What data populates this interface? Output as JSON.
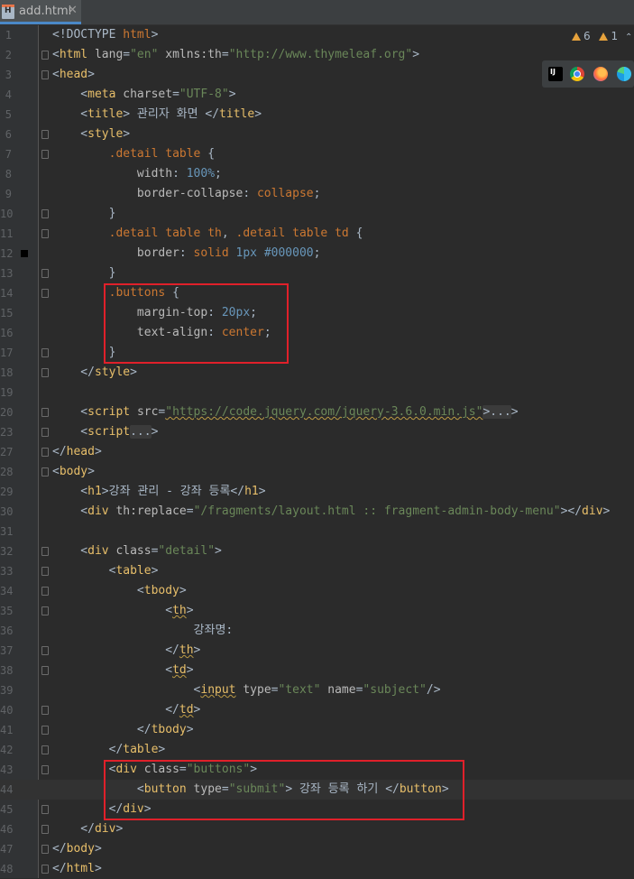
{
  "tab": {
    "filename": "add.html",
    "close_glyph": "✕"
  },
  "inspections": {
    "warnings": "6",
    "weak_warnings": "1"
  },
  "browsers": [
    "intellij-preview-icon",
    "chrome-icon",
    "firefox-icon",
    "edge-icon"
  ],
  "colors": {
    "highlight_box": "#e0202a",
    "tag": "#e8bf6a",
    "string": "#6a8759",
    "keyword": "#cc7832"
  },
  "lines": [
    {
      "n": "1",
      "tokens": [
        [
          "txt",
          "<!DOCTYPE "
        ],
        [
          "kw",
          "html"
        ],
        [
          "txt",
          ">"
        ]
      ]
    },
    {
      "n": "2",
      "tokens": [
        [
          "txt",
          "<"
        ],
        [
          "tag",
          "html"
        ],
        [
          "txt",
          " "
        ],
        [
          "attr",
          "lang"
        ],
        [
          "txt",
          "="
        ],
        [
          "str",
          "\"en\""
        ],
        [
          "txt",
          " "
        ],
        [
          "attr",
          "xmlns:th"
        ],
        [
          "txt",
          "="
        ],
        [
          "str",
          "\"http://www.thymeleaf.org\""
        ],
        [
          "txt",
          ">"
        ]
      ]
    },
    {
      "n": "3",
      "tokens": [
        [
          "txt",
          "<"
        ],
        [
          "tag",
          "head"
        ],
        [
          "txt",
          ">"
        ]
      ]
    },
    {
      "n": "4",
      "tokens": [
        [
          "txt",
          "    <"
        ],
        [
          "tag",
          "meta"
        ],
        [
          "txt",
          " "
        ],
        [
          "attr",
          "charset"
        ],
        [
          "txt",
          "="
        ],
        [
          "str",
          "\"UTF-8\""
        ],
        [
          "txt",
          ">"
        ]
      ]
    },
    {
      "n": "5",
      "tokens": [
        [
          "txt",
          "    <"
        ],
        [
          "tag",
          "title"
        ],
        [
          "txt",
          "> 관리자 화면 </"
        ],
        [
          "tag",
          "title"
        ],
        [
          "txt",
          ">"
        ]
      ]
    },
    {
      "n": "6",
      "tokens": [
        [
          "txt",
          "    <"
        ],
        [
          "tag",
          "style"
        ],
        [
          "txt",
          ">"
        ]
      ]
    },
    {
      "n": "7",
      "tokens": [
        [
          "txt",
          "        "
        ],
        [
          "sel",
          ".detail table"
        ],
        [
          "txt",
          " {"
        ]
      ]
    },
    {
      "n": "8",
      "tokens": [
        [
          "txt",
          "            "
        ],
        [
          "prop",
          "width"
        ],
        [
          "txt",
          ": "
        ],
        [
          "num",
          "100%"
        ],
        [
          "txt",
          ";"
        ]
      ]
    },
    {
      "n": "9",
      "tokens": [
        [
          "txt",
          "            "
        ],
        [
          "prop",
          "border-collapse"
        ],
        [
          "txt",
          ": "
        ],
        [
          "kw",
          "collapse"
        ],
        [
          "txt",
          ";"
        ]
      ]
    },
    {
      "n": "10",
      "tokens": [
        [
          "txt",
          "        }"
        ]
      ]
    },
    {
      "n": "11",
      "tokens": [
        [
          "txt",
          "        "
        ],
        [
          "sel",
          ".detail table th"
        ],
        [
          "txt",
          ", "
        ],
        [
          "sel",
          ".detail table td"
        ],
        [
          "txt",
          " {"
        ]
      ]
    },
    {
      "n": "12",
      "tokens": [
        [
          "txt",
          "            "
        ],
        [
          "prop",
          "border"
        ],
        [
          "txt",
          ": "
        ],
        [
          "kw",
          "solid"
        ],
        [
          "txt",
          " "
        ],
        [
          "num",
          "1px"
        ],
        [
          "txt",
          " "
        ],
        [
          "num",
          "#000000"
        ],
        [
          "txt",
          ";"
        ]
      ]
    },
    {
      "n": "13",
      "tokens": [
        [
          "txt",
          "        }"
        ]
      ]
    },
    {
      "n": "14",
      "tokens": [
        [
          "txt",
          "        "
        ],
        [
          "sel",
          ".buttons"
        ],
        [
          "txt",
          " {"
        ]
      ]
    },
    {
      "n": "15",
      "tokens": [
        [
          "txt",
          "            "
        ],
        [
          "prop",
          "margin-top"
        ],
        [
          "txt",
          ": "
        ],
        [
          "num",
          "20px"
        ],
        [
          "txt",
          ";"
        ]
      ]
    },
    {
      "n": "16",
      "tokens": [
        [
          "txt",
          "            "
        ],
        [
          "prop",
          "text-align"
        ],
        [
          "txt",
          ": "
        ],
        [
          "kw",
          "center"
        ],
        [
          "txt",
          ";"
        ]
      ]
    },
    {
      "n": "17",
      "tokens": [
        [
          "txt",
          "        }"
        ]
      ]
    },
    {
      "n": "18",
      "tokens": [
        [
          "txt",
          "    </"
        ],
        [
          "tag",
          "style"
        ],
        [
          "txt",
          ">"
        ]
      ]
    },
    {
      "n": "19",
      "tokens": []
    },
    {
      "n": "20",
      "tokens": [
        [
          "txt",
          "    <"
        ],
        [
          "tag",
          "script"
        ],
        [
          "txt",
          " "
        ],
        [
          "attr",
          "src"
        ],
        [
          "txt",
          "="
        ],
        [
          "stru",
          "\"https://code.jquery.com/jquery-3.6.0.min.js\""
        ],
        [
          "fold",
          ">..."
        ],
        [
          "txt",
          ">"
        ]
      ]
    },
    {
      "n": "23",
      "tokens": [
        [
          "txt",
          "    <"
        ],
        [
          "tag",
          "script"
        ],
        [
          "fold",
          "..."
        ],
        [
          "txt",
          ">"
        ]
      ]
    },
    {
      "n": "27",
      "tokens": [
        [
          "txt",
          "</"
        ],
        [
          "tag",
          "head"
        ],
        [
          "txt",
          ">"
        ]
      ]
    },
    {
      "n": "28",
      "tokens": [
        [
          "txt",
          "<"
        ],
        [
          "tag",
          "body"
        ],
        [
          "txt",
          ">"
        ]
      ]
    },
    {
      "n": "29",
      "tokens": [
        [
          "txt",
          "    <"
        ],
        [
          "tag",
          "h1"
        ],
        [
          "txt",
          ">강좌 관리 - 강좌 등록</"
        ],
        [
          "tag",
          "h1"
        ],
        [
          "txt",
          ">"
        ]
      ]
    },
    {
      "n": "30",
      "tokens": [
        [
          "txt",
          "    <"
        ],
        [
          "tag",
          "div"
        ],
        [
          "txt",
          " "
        ],
        [
          "attr",
          "th:replace"
        ],
        [
          "txt",
          "="
        ],
        [
          "str",
          "\"/fragments/layout.html :: fragment-admin-body-menu\""
        ],
        [
          "txt",
          "></"
        ],
        [
          "tag",
          "div"
        ],
        [
          "txt",
          ">"
        ]
      ]
    },
    {
      "n": "31",
      "tokens": []
    },
    {
      "n": "32",
      "tokens": [
        [
          "txt",
          "    <"
        ],
        [
          "tag",
          "div"
        ],
        [
          "txt",
          " "
        ],
        [
          "attr",
          "class"
        ],
        [
          "txt",
          "="
        ],
        [
          "str",
          "\"detail\""
        ],
        [
          "txt",
          ">"
        ]
      ]
    },
    {
      "n": "33",
      "tokens": [
        [
          "txt",
          "        <"
        ],
        [
          "tag",
          "table"
        ],
        [
          "txt",
          ">"
        ]
      ]
    },
    {
      "n": "34",
      "tokens": [
        [
          "txt",
          "            <"
        ],
        [
          "tag",
          "tbody"
        ],
        [
          "txt",
          ">"
        ]
      ]
    },
    {
      "n": "35",
      "tokens": [
        [
          "txt",
          "                <"
        ],
        [
          "tagu",
          "th"
        ],
        [
          "txt",
          ">"
        ]
      ]
    },
    {
      "n": "36",
      "tokens": [
        [
          "txt",
          "                    강좌명:"
        ]
      ]
    },
    {
      "n": "37",
      "tokens": [
        [
          "txt",
          "                </"
        ],
        [
          "tagu",
          "th"
        ],
        [
          "txt",
          ">"
        ]
      ]
    },
    {
      "n": "38",
      "tokens": [
        [
          "txt",
          "                <"
        ],
        [
          "tagu",
          "td"
        ],
        [
          "txt",
          ">"
        ]
      ]
    },
    {
      "n": "39",
      "tokens": [
        [
          "txt",
          "                    <"
        ],
        [
          "tagu",
          "input"
        ],
        [
          "txt",
          " "
        ],
        [
          "attr",
          "type"
        ],
        [
          "txt",
          "="
        ],
        [
          "str",
          "\"text\""
        ],
        [
          "txt",
          " "
        ],
        [
          "attr",
          "name"
        ],
        [
          "txt",
          "="
        ],
        [
          "str",
          "\"subject\""
        ],
        [
          "txt",
          "/>"
        ]
      ]
    },
    {
      "n": "40",
      "tokens": [
        [
          "txt",
          "                </"
        ],
        [
          "tagu",
          "td"
        ],
        [
          "txt",
          ">"
        ]
      ]
    },
    {
      "n": "41",
      "tokens": [
        [
          "txt",
          "            </"
        ],
        [
          "tag",
          "tbody"
        ],
        [
          "txt",
          ">"
        ]
      ]
    },
    {
      "n": "42",
      "tokens": [
        [
          "txt",
          "        </"
        ],
        [
          "tag",
          "table"
        ],
        [
          "txt",
          ">"
        ]
      ]
    },
    {
      "n": "43",
      "tokens": [
        [
          "txt",
          "        <"
        ],
        [
          "tag",
          "div"
        ],
        [
          "txt",
          " "
        ],
        [
          "attr",
          "class"
        ],
        [
          "txt",
          "="
        ],
        [
          "str",
          "\"buttons\""
        ],
        [
          "txt",
          ">"
        ]
      ]
    },
    {
      "n": "44",
      "tokens": [
        [
          "txt",
          "            <"
        ],
        [
          "tag",
          "button"
        ],
        [
          "txt",
          " "
        ],
        [
          "attr",
          "type"
        ],
        [
          "txt",
          "="
        ],
        [
          "str",
          "\"submit\""
        ],
        [
          "txt",
          "> 강좌 등록 하기 </"
        ],
        [
          "tag",
          "button"
        ],
        [
          "txt",
          ">"
        ]
      ]
    },
    {
      "n": "45",
      "tokens": [
        [
          "txt",
          "        </"
        ],
        [
          "tag",
          "div"
        ],
        [
          "txt",
          ">"
        ]
      ]
    },
    {
      "n": "46",
      "tokens": [
        [
          "txt",
          "    </"
        ],
        [
          "tag",
          "div"
        ],
        [
          "txt",
          ">"
        ]
      ]
    },
    {
      "n": "47",
      "tokens": [
        [
          "txt",
          "</"
        ],
        [
          "tag",
          "body"
        ],
        [
          "txt",
          ">"
        ]
      ]
    },
    {
      "n": "48",
      "tokens": [
        [
          "txt",
          "</"
        ],
        [
          "tag",
          "html"
        ],
        [
          "txt",
          ">"
        ]
      ]
    }
  ]
}
